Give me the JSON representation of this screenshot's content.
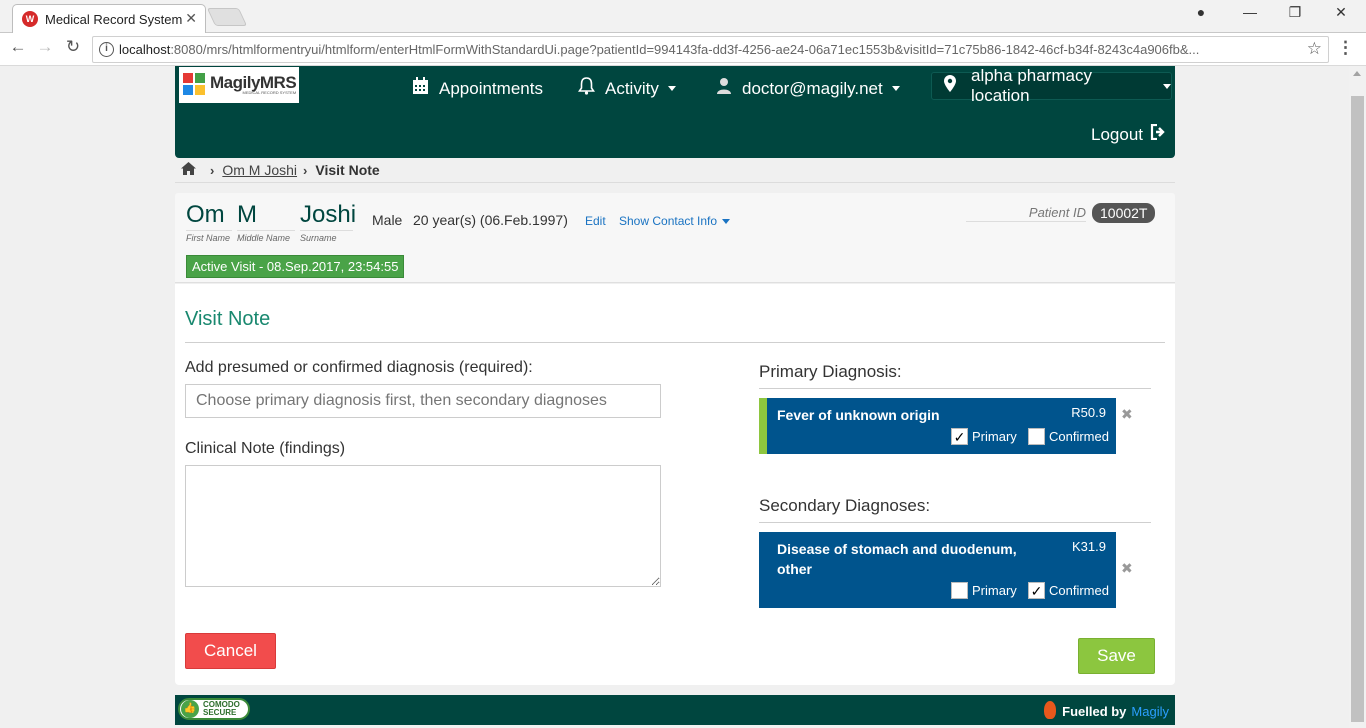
{
  "browser": {
    "tab_title": "Medical Record System",
    "tab_favicon": "MRS",
    "url_host": "localhost",
    "url_rest": ":8080/mrs/htmlformentryui/htmlform/enterHtmlFormWithStandardUi.page?patientId=994143fa-dd3f-4256-ae24-06a71ec1553b&visitId=71c75b86-1842-46cf-b34f-8243c4a906fb&..."
  },
  "header": {
    "logo_text": "MagilyMRS",
    "logo_sub": "MEDICAL RECORD SYSTEM",
    "appointments": "Appointments",
    "activity": "Activity",
    "user": "doctor@magily.net",
    "location": "alpha pharmacy location",
    "logout": "Logout"
  },
  "breadcrumb": {
    "patient": "Om M Joshi",
    "current": "Visit Note"
  },
  "patient": {
    "first_name": "Om",
    "middle_name": "M",
    "surname": "Joshi",
    "first_name_label": "First Name",
    "middle_name_label": "Middle Name",
    "surname_label": "Surname",
    "gender": "Male",
    "age": "20 year(s) (06.Feb.1997)",
    "edit": "Edit",
    "show_contact": "Show Contact Info",
    "patient_id_label": "Patient ID",
    "patient_id": "10002T",
    "active_visit": "Active Visit - 08.Sep.2017, 23:54:55"
  },
  "form": {
    "title": "Visit Note",
    "diagnosis_label": "Add presumed or confirmed diagnosis (required):",
    "diagnosis_placeholder": "Choose primary diagnosis first, then secondary diagnoses",
    "clinical_label": "Clinical Note (findings)",
    "clinical_value": "",
    "primary_heading": "Primary Diagnosis:",
    "secondary_heading": "Secondary Diagnoses:",
    "primary_diagnosis": {
      "name": "Fever of unknown origin",
      "code": "R50.9",
      "primary_label": "Primary",
      "primary_checked": true,
      "confirmed_label": "Confirmed",
      "confirmed_checked": false
    },
    "secondary_diagnosis": {
      "name": "Disease of stomach and duodenum, other",
      "code": "K31.9",
      "primary_label": "Primary",
      "primary_checked": false,
      "confirmed_label": "Confirmed",
      "confirmed_checked": true
    },
    "cancel": "Cancel",
    "save": "Save"
  },
  "footer": {
    "secure_line1": "COMODO",
    "secure_line2": "SECURE",
    "fuelled_by": "Fuelled by",
    "brand": "Magily"
  },
  "colors": {
    "header_bg": "#00463f",
    "diagnosis_card": "#00548d",
    "primary_marker": "#8ec63f",
    "visit_badge": "#4aa348",
    "cancel": "#f24c4c",
    "save": "#8cc63f",
    "link": "#1a73c2",
    "title": "#19886f"
  },
  "icons": {
    "appointments": "calendar-icon",
    "activity": "bell-icon",
    "user": "user-icon",
    "location": "map-marker-icon",
    "logout": "sign-out-icon",
    "home": "home-icon",
    "remove": "close-icon"
  }
}
